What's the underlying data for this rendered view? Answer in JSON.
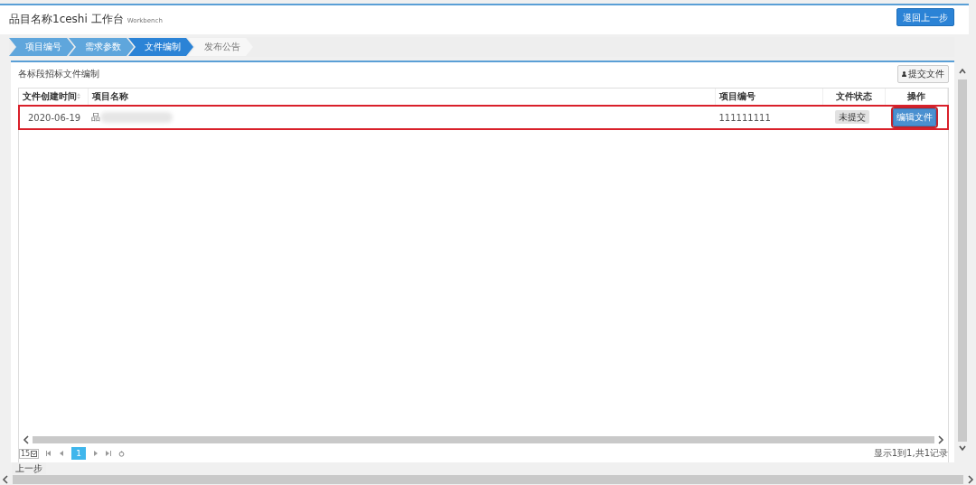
{
  "header": {
    "title": "品目名称1ceshi 工作台",
    "subtitle": "Workbench",
    "back_button": "退回上一步"
  },
  "steps": [
    {
      "label": "项目编号",
      "selected": false,
      "done": true
    },
    {
      "label": "需求参数",
      "selected": false,
      "done": true
    },
    {
      "label": "文件编制",
      "selected": true,
      "done": false
    },
    {
      "label": "发布公告",
      "selected": false,
      "done": false
    }
  ],
  "panel": {
    "title": "各标段招标文件编制",
    "submit_button": "提交文件"
  },
  "table": {
    "columns": [
      {
        "label": "文件创建时间",
        "sortable": true
      },
      {
        "label": "项目名称",
        "sortable": false
      },
      {
        "label": "项目编号",
        "sortable": false
      },
      {
        "label": "文件状态",
        "sortable": false
      },
      {
        "label": "操作",
        "sortable": false
      }
    ],
    "rows": [
      {
        "date": "2020-06-19",
        "name": "品",
        "number": "111111111",
        "status": "未提交",
        "action": "编辑文件",
        "highlighted": true
      }
    ]
  },
  "pager": {
    "page_size": "15",
    "pages": [
      {
        "label": "1",
        "selected": true
      }
    ],
    "info": "显示1到1,共1记录"
  },
  "prev_step_button": "上一步"
}
